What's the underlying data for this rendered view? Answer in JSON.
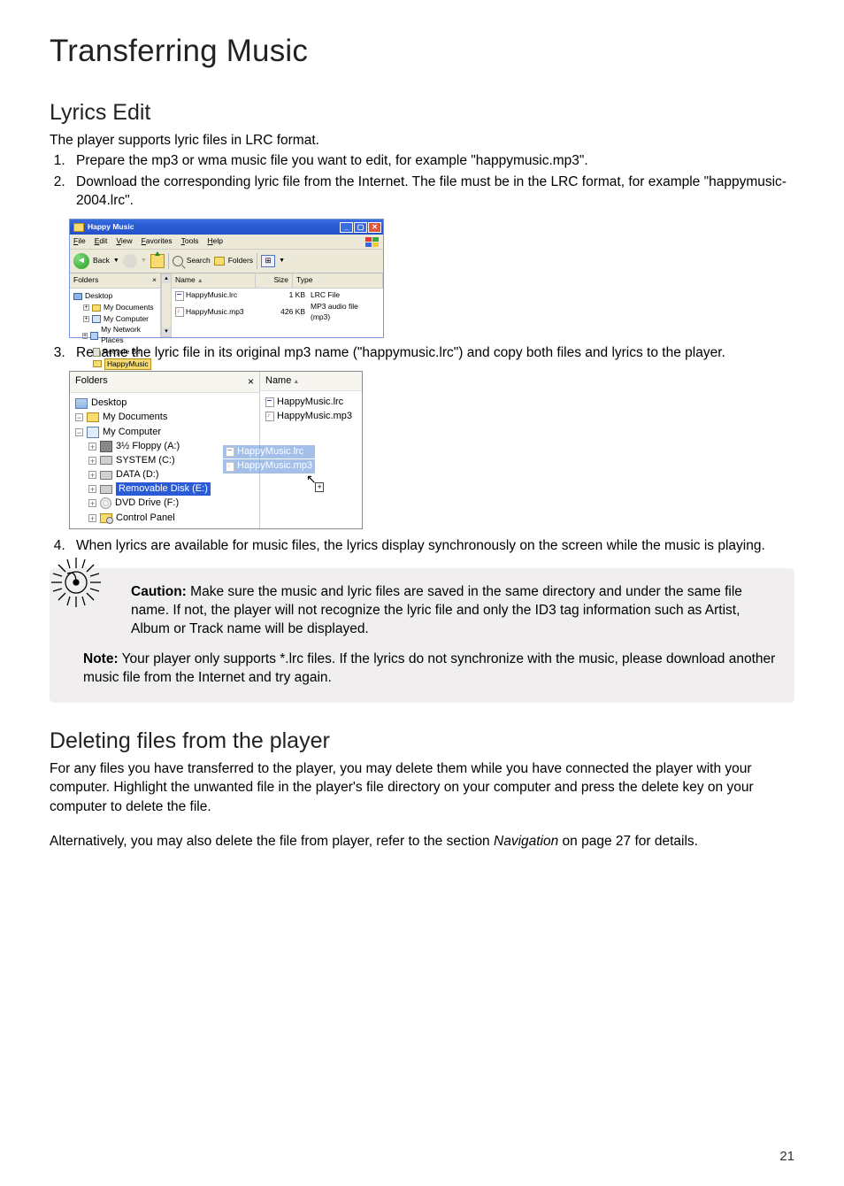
{
  "headings": {
    "h1": "Transferring Music",
    "h2a": "Lyrics Edit",
    "h2b": "Deleting files from the player"
  },
  "lyrics": {
    "intro": "The player supports lyric files in LRC format.",
    "step1": "Prepare the mp3 or wma music file you want to edit, for example \"happymusic.mp3\".",
    "step2": "Download the corresponding lyric file from the Internet. The file must be in the LRC format, for example \"happymusic-2004.lrc\".",
    "step3": "Rename the lyric file in its original mp3 name (\"happymusic.lrc\") and copy both files and lyrics to the player.",
    "step4": "When lyrics are available for music files, the lyrics display synchronously on the screen while the music is playing."
  },
  "win1": {
    "title": "Happy Music",
    "menu": {
      "file": "File",
      "edit": "Edit",
      "view": "View",
      "favorites": "Favorites",
      "tools": "Tools",
      "help": "Help"
    },
    "toolbar": {
      "back": "Back",
      "search": "Search",
      "folders": "Folders"
    },
    "side_hd": "Folders",
    "tree": {
      "desktop": "Desktop",
      "mydocs": "My Documents",
      "mycomp": "My Computer",
      "mynet": "My Network Places",
      "recycle": "Recycle Bin",
      "happy": "HappyMusic"
    },
    "cols": {
      "name": "Name",
      "size": "Size",
      "type": "Type"
    },
    "rows": [
      {
        "name": "HappyMusic.lrc",
        "size": "1 KB",
        "type": "LRC File"
      },
      {
        "name": "HappyMusic.mp3",
        "size": "426 KB",
        "type": "MP3 audio file (mp3)"
      }
    ]
  },
  "win2": {
    "side_hd": "Folders",
    "tree": {
      "desktop": "Desktop",
      "mydocs": "My Documents",
      "mycomp": "My Computer",
      "floppy": "3½ Floppy (A:)",
      "system": "SYSTEM (C:)",
      "data": "DATA (D:)",
      "removable": "Removable Disk (E:)",
      "dvd": "DVD Drive (F:)",
      "cpl": "Control Panel"
    },
    "col_name": "Name",
    "rows": [
      {
        "name": "HappyMusic.lrc"
      },
      {
        "name": "HappyMusic.mp3"
      }
    ],
    "drag": [
      {
        "name": "HappyMusic.lrc"
      },
      {
        "name": "HappyMusic.mp3"
      }
    ]
  },
  "notes": {
    "caution_label": "Caution:",
    "caution_text": " Make sure the music and lyric files are saved in the same directory and under the same file name. If not, the player will not recognize the lyric file and only the ID3 tag information such as Artist, Album or Track name will be displayed.",
    "note_label": "Note:",
    "note_text": " Your player only supports *.lrc files. If the lyrics do not synchronize with the music, please download another music file from the Internet and try again."
  },
  "delete": {
    "p1": "For any files you have transferred to the player, you may delete them while you have connected the player with your computer. Highlight the unwanted file in the player's file directory on your computer and press the delete key on your computer to delete the file.",
    "p2a": "Alternatively, you may also delete the file from player, refer to the section ",
    "p2_em": "Navigation",
    "p2b": " on page 27 for details."
  },
  "page_number": "21"
}
